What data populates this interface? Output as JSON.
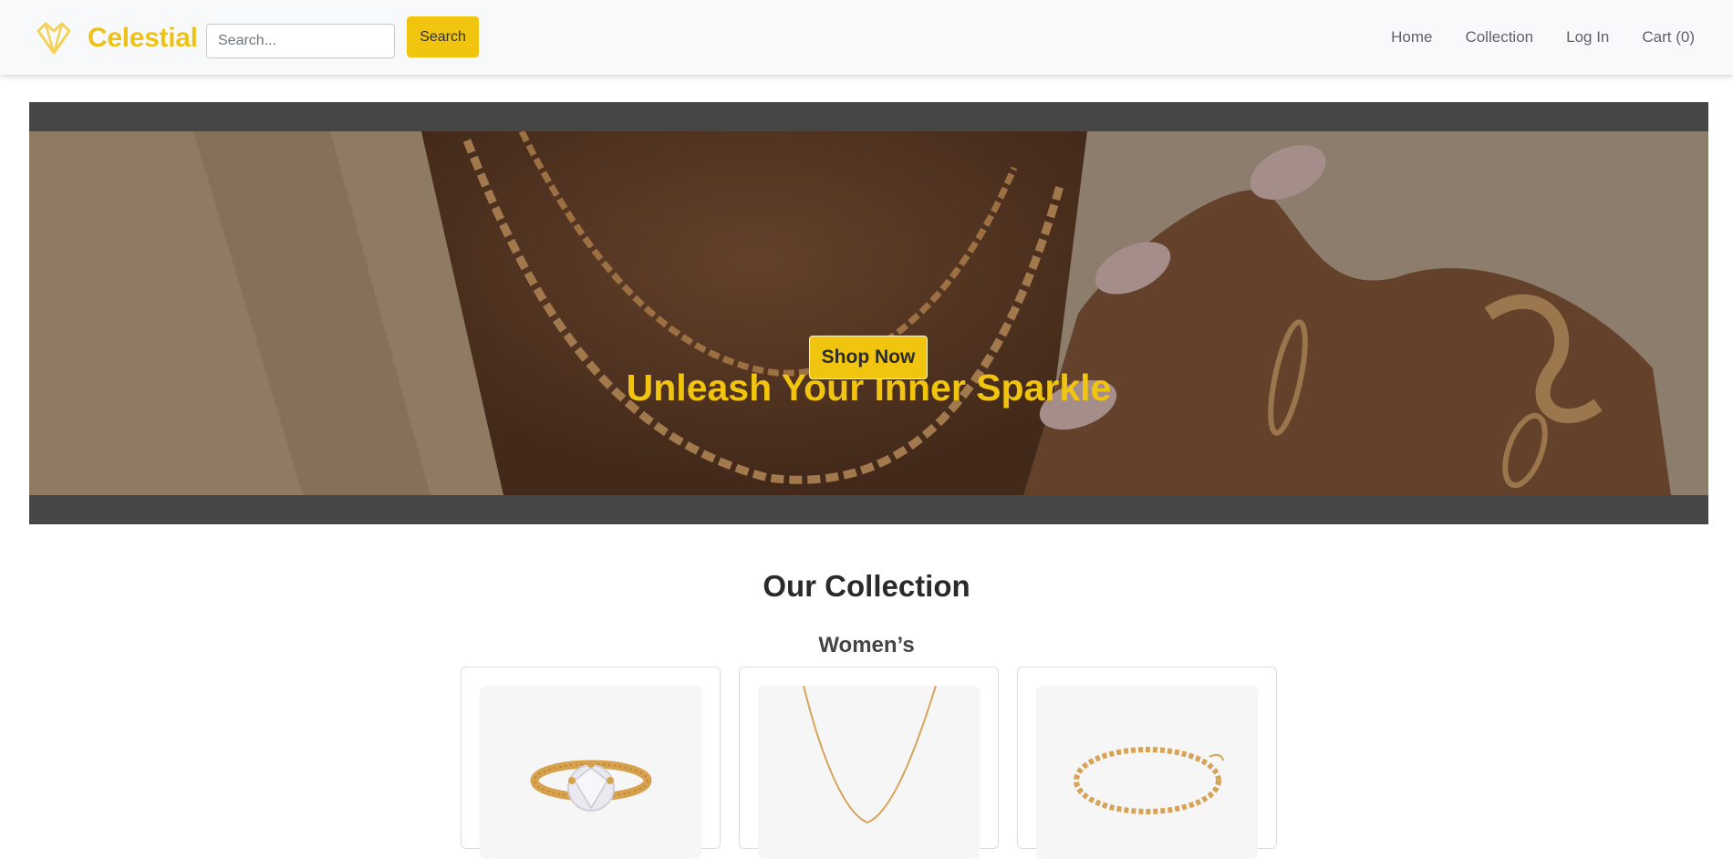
{
  "brand": {
    "name": "Celestial",
    "logo_icon": "diamond-icon",
    "accent_color": "#f1c40f"
  },
  "search": {
    "placeholder": "Search...",
    "button_label": "Search"
  },
  "nav": {
    "home": "Home",
    "collection": "Collection",
    "login": "Log In",
    "cart": "Cart (0)"
  },
  "hero": {
    "title": "Unleash Your Inner Sparkle",
    "cta_label": "Shop Now"
  },
  "collection": {
    "title": "Our Collection",
    "category": "Women’s",
    "products": [
      {
        "image": "gold-solitaire-ring"
      },
      {
        "image": "gold-chain-necklace"
      },
      {
        "image": "gold-tennis-bracelet"
      }
    ]
  }
}
